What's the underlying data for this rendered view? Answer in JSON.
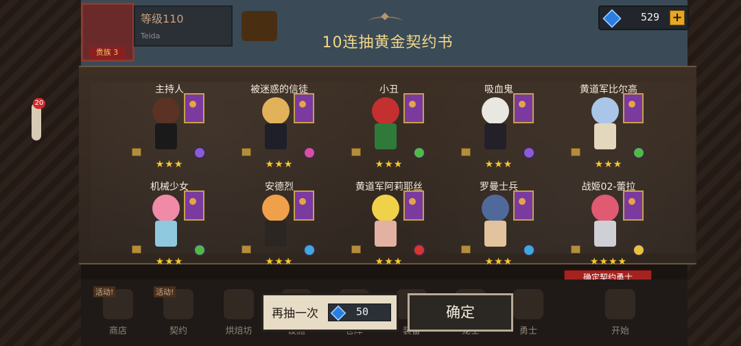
{
  "header": {
    "level_text": "等级110",
    "player_name": "Teida",
    "rank_badge": "贵族 3",
    "currency_value": "529",
    "currency_plus": "+"
  },
  "title": "10连抽黄金契约书",
  "results": [
    {
      "name": "主持人",
      "stars": "★★★",
      "hair": "#5a3324",
      "outfit": "#1a1a1a",
      "element": "#8a5bd6"
    },
    {
      "name": "被迷惑的信徒",
      "stars": "★★★",
      "hair": "#e2b25a",
      "outfit": "#1f1f2a",
      "element": "#d84fa0"
    },
    {
      "name": "小丑",
      "stars": "★★★",
      "hair": "#c43030",
      "outfit": "#2f7a3a",
      "element": "#52b84a"
    },
    {
      "name": "吸血鬼",
      "stars": "★★★",
      "hair": "#e8e8e0",
      "outfit": "#23202a",
      "element": "#8a5bd6"
    },
    {
      "name": "黄道军比尔高",
      "stars": "★★★",
      "hair": "#a9c6e8",
      "outfit": "#e3d7bd",
      "element": "#52b84a"
    },
    {
      "name": "机械少女",
      "stars": "★★★",
      "hair": "#f08aa6",
      "outfit": "#8fc9df",
      "element": "#52b84a"
    },
    {
      "name": "安德烈",
      "stars": "★★★",
      "hair": "#f0a04a",
      "outfit": "#2c2622",
      "element": "#3fa8e0"
    },
    {
      "name": "黄道军阿莉耶丝",
      "stars": "★★★",
      "hair": "#f0d14a",
      "outfit": "#e3b1a2",
      "element": "#d83434"
    },
    {
      "name": "罗曼士兵",
      "stars": "★★★",
      "hair": "#4f6a9a",
      "outfit": "#e2c39d",
      "element": "#3fa8e0"
    },
    {
      "name": "战姬02-蕾拉",
      "stars": "★★★★",
      "hair": "#e05a72",
      "outfit": "#cfcfd6",
      "element": "#e8c23a"
    }
  ],
  "confirm_badge": "确定契约勇士",
  "nav": {
    "items": [
      "商店",
      "契约",
      "烘焙坊",
      "设施",
      "仓库",
      "装备",
      "宠士",
      "勇士",
      "开始"
    ],
    "tags": [
      "活动!",
      "活动!"
    ]
  },
  "buttons": {
    "redraw_label": "再抽一次",
    "redraw_cost": "50",
    "confirm_label": "确定"
  },
  "colors": {
    "title": "#f1d88a",
    "star": "#f6c829",
    "gem": "#2a7de1",
    "badge_red": "#a4231f",
    "panel": "#3d2f24"
  }
}
